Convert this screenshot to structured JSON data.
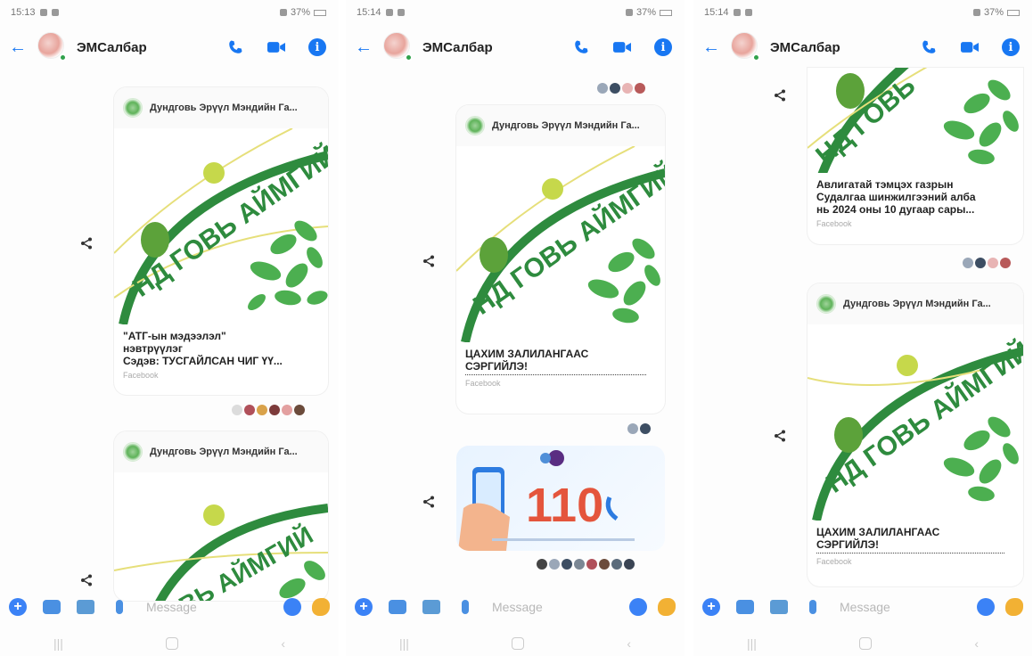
{
  "panels": [
    {
      "time": "15:13",
      "battery": "37%",
      "title": "ЭМСалбар",
      "cards": [
        {
          "page_name": "Дундговь Эрүүл Мэндийн Га...",
          "title": "\"АТГ-ын мэдээлэл\"\nнэвтрүүлэг\nСэдэв: ТУСГАЙЛСАН ЧИГ ҮҮ...",
          "source": "Facebook"
        },
        {
          "page_name": "Дундговь Эрүүл Мэндийн Га...",
          "title": "",
          "source": ""
        }
      ],
      "logo_text": "НД ГОВЬ АЙМГИЙ",
      "composer_placeholder": "Message"
    },
    {
      "time": "15:14",
      "battery": "37%",
      "title": "ЭМСалбар",
      "cards": [
        {
          "page_name": "Дундговь Эрүүл Мэндийн Га...",
          "title": "ЦАХИМ ЗАЛИЛАНГААС\nСЭРГИЙЛЭ!",
          "source": "Facebook"
        }
      ],
      "logo_text": "НД ГОВЬ АЙМГИЙ",
      "promo_number": "110",
      "composer_placeholder": "Message"
    },
    {
      "time": "15:14",
      "battery": "37%",
      "title": "ЭМСалбар",
      "cards": [
        {
          "page_name": "",
          "title": "Авлигатай тэмцэх газрын\nСудалгаа шинжилгээний алба\nнь 2024 оны 10 дугаар сары...",
          "source": "Facebook"
        },
        {
          "page_name": "Дундговь Эрүүл Мэндийн Га...",
          "title": "ЦАХИМ ЗАЛИЛАНГААС\nСЭРГИЙЛЭ!",
          "source": "Facebook"
        }
      ],
      "logo_text": "НД ГОВЬ АЙМГИЙ",
      "composer_placeholder": "Message"
    }
  ],
  "colors": {
    "accent": "#1877f2",
    "logo_green": "#2e8b3e",
    "leaf_green": "#5bb75b",
    "promo_red": "#e4553c"
  }
}
